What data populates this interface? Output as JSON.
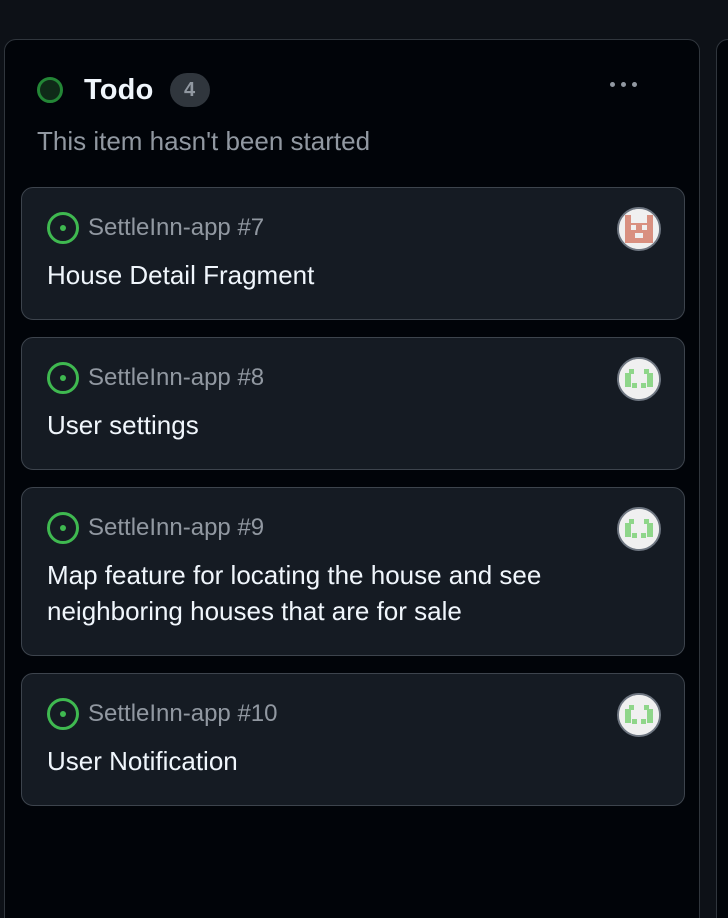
{
  "column": {
    "title": "Todo",
    "count": "4",
    "description": "This item hasn't been started",
    "status_color": "#238636",
    "menu_icon": "kebab-horizontal-icon"
  },
  "cards": [
    {
      "repo_ref": "SettleInn-app #7",
      "title": "House Detail Fragment",
      "status_icon": "issue-opened-icon",
      "avatar_color": "#d99080"
    },
    {
      "repo_ref": "SettleInn-app #8",
      "title": "User settings",
      "status_icon": "issue-opened-icon",
      "avatar_color": "#8fd68a"
    },
    {
      "repo_ref": "SettleInn-app #9",
      "title": "Map feature for locating the house and see neighboring houses that are for sale",
      "status_icon": "issue-opened-icon",
      "avatar_color": "#8fd68a"
    },
    {
      "repo_ref": "SettleInn-app #10",
      "title": "User Notification",
      "status_icon": "issue-opened-icon",
      "avatar_color": "#8fd68a"
    }
  ]
}
